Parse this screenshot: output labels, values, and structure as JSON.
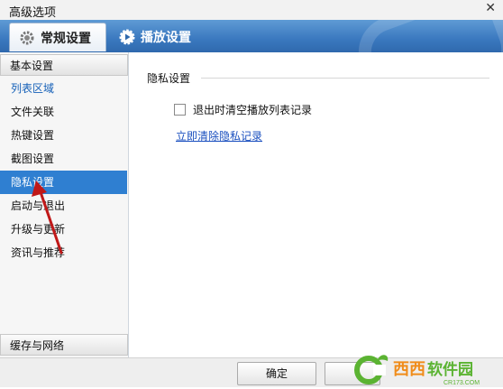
{
  "window": {
    "title": "高级选项"
  },
  "tabs": [
    {
      "label": "常规设置",
      "icon": "gear-icon",
      "active": true
    },
    {
      "label": "播放设置",
      "icon": "play-gear-icon",
      "active": false
    }
  ],
  "sidebar": {
    "header_top": "基本设置",
    "items": [
      {
        "label": "列表区域"
      },
      {
        "label": "文件关联"
      },
      {
        "label": "热键设置"
      },
      {
        "label": "截图设置"
      },
      {
        "label": "隐私设置",
        "selected": true
      },
      {
        "label": "启动与退出"
      },
      {
        "label": "升级与更新"
      },
      {
        "label": "资讯与推荐"
      }
    ],
    "header_bottom": "缓存与网络"
  },
  "content": {
    "section_title": "隐私设置",
    "checkbox_label": "退出时清空播放列表记录",
    "checkbox_checked": false,
    "clear_link": "立即清除隐私记录"
  },
  "footer": {
    "ok_label": "确定"
  },
  "watermark": {
    "brand": "西西软件园",
    "url": "CR173.COM"
  },
  "colors": {
    "tab_bar": "#3a78bf",
    "selected_item": "#2f7fd1",
    "link": "#1a4fbf",
    "arrow": "#c01818",
    "watermark_green": "#5bb332"
  }
}
